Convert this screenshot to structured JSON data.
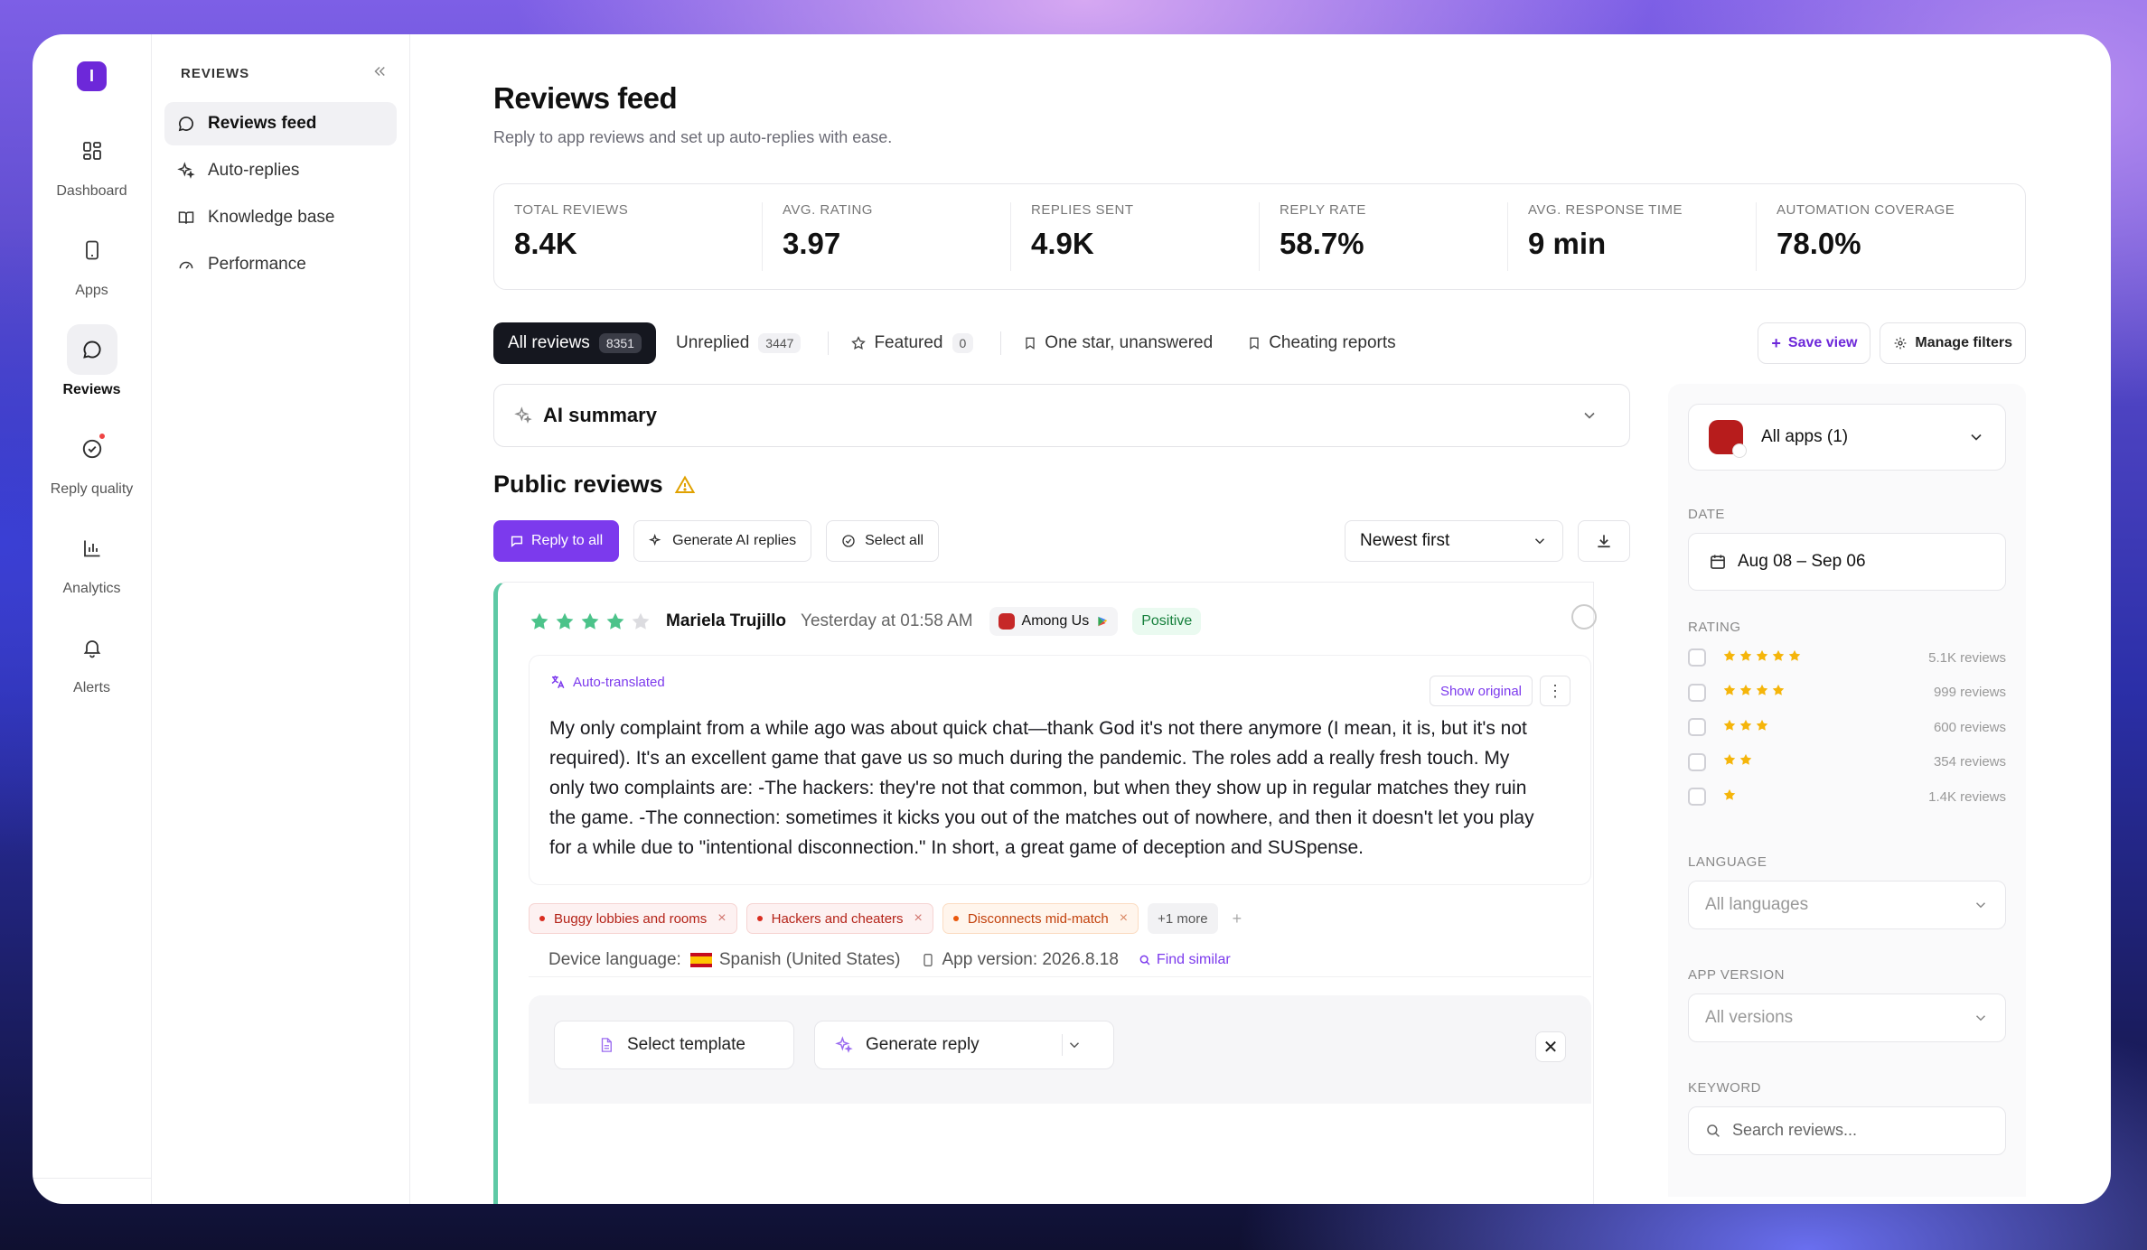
{
  "brand": {
    "logo_letter": "I",
    "accent": "#7c3aed"
  },
  "rail": [
    {
      "label": "Dashboard",
      "icon": "grid-icon"
    },
    {
      "label": "Apps",
      "icon": "phone-icon"
    },
    {
      "label": "Reviews",
      "icon": "chat-icon",
      "active": true
    },
    {
      "label": "Reply quality",
      "icon": "check-badge-icon",
      "badge": true
    },
    {
      "label": "Analytics",
      "icon": "bar-chart-icon"
    },
    {
      "label": "Alerts",
      "icon": "bell-icon"
    }
  ],
  "sidebar": {
    "title": "REVIEWS",
    "items": [
      {
        "label": "Reviews feed",
        "icon": "chat-icon",
        "active": true
      },
      {
        "label": "Auto-replies",
        "icon": "sparkles-icon"
      },
      {
        "label": "Knowledge base",
        "icon": "book-icon"
      },
      {
        "label": "Performance",
        "icon": "gauge-icon"
      }
    ]
  },
  "header": {
    "title": "Reviews feed",
    "subtitle": "Reply to app reviews and set up auto-replies with ease."
  },
  "stats": [
    {
      "label": "Total reviews",
      "value": "8.4K"
    },
    {
      "label": "Avg. rating",
      "value": "3.97"
    },
    {
      "label": "Replies sent",
      "value": "4.9K"
    },
    {
      "label": "Reply rate",
      "value": "58.7%"
    },
    {
      "label": "Avg. response time",
      "value": "9 min"
    },
    {
      "label": "Automation coverage",
      "value": "78.0%"
    }
  ],
  "tabs": [
    {
      "label": "All reviews",
      "count": "8351",
      "active": true
    },
    {
      "label": "Unreplied",
      "count": "3447"
    },
    {
      "label": "Featured",
      "count": "0",
      "icon": "star-outline-icon"
    },
    {
      "label": "One star, unanswered",
      "icon": "bookmark-icon"
    },
    {
      "label": "Cheating reports",
      "icon": "bookmark-icon"
    }
  ],
  "tab_actions": {
    "save_view": "Save view",
    "manage_filters": "Manage filters"
  },
  "ai_summary": {
    "label": "AI summary"
  },
  "public_reviews": {
    "title": "Public reviews",
    "reply_all": "Reply to all",
    "generate_ai": "Generate AI replies",
    "select_all": "Select all",
    "sort": "Newest first"
  },
  "review": {
    "rating": 4,
    "reviewer": "Mariela Trujillo",
    "time": "Yesterday at 01:58 AM",
    "app": "Among Us",
    "sentiment": "Positive",
    "auto_translated": "Auto-translated",
    "show_original": "Show original",
    "text": "My only complaint from a while ago was about quick chat—thank God it's not there anymore (I mean, it is, but it's not required). It's an excellent game that gave us so much during the pandemic. The roles add a really fresh touch. My only two complaints are: -The hackers: they're not that common, but when they show up in regular matches they ruin the game. -The connection: sometimes it kicks you out of the matches out of nowhere, and then it doesn't let you play for a while due to \"intentional disconnection.\" In short, a great game of deception and SUSpense.",
    "tags": [
      {
        "label": "Buggy lobbies and rooms",
        "color": "red"
      },
      {
        "label": "Hackers and cheaters",
        "color": "red"
      },
      {
        "label": "Disconnects mid-match",
        "color": "orange"
      }
    ],
    "more_tags": "+1 more",
    "add_tag": "+",
    "device_language_label": "Device language:",
    "device_language": "Spanish (United States)",
    "app_version": "App version: 2026.8.18",
    "find_similar": "Find similar"
  },
  "reply_panel": {
    "select_template": "Select template",
    "generate_reply": "Generate reply"
  },
  "filters": {
    "app_select": "All apps (1)",
    "date_label": "Date",
    "date_value": "Aug 08 – Sep 06",
    "rating_label": "Rating",
    "ratings": [
      {
        "stars": 5,
        "count": "5.1K reviews"
      },
      {
        "stars": 4,
        "count": "999 reviews"
      },
      {
        "stars": 3,
        "count": "600 reviews"
      },
      {
        "stars": 2,
        "count": "354 reviews"
      },
      {
        "stars": 1,
        "count": "1.4K reviews"
      }
    ],
    "language_label": "Language",
    "language_value": "All languages",
    "version_label": "App version",
    "version_value": "All versions",
    "keyword_label": "Keyword",
    "keyword_placeholder": "Search reviews..."
  }
}
